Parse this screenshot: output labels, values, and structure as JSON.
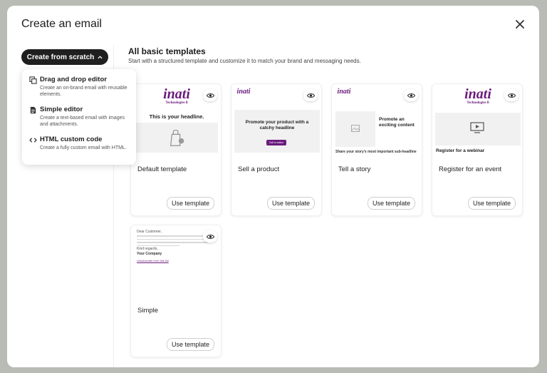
{
  "modal": {
    "title": "Create an email"
  },
  "sidebar": {
    "scratch_label": "Create from scratch",
    "menu": [
      {
        "title": "Drag and drop editor",
        "desc": "Create an on-brand email with reusable elements."
      },
      {
        "title": "Simple editor",
        "desc": "Create a text-based email with images and attachments."
      },
      {
        "title": "HTML custom code",
        "desc": "Create a fully custom email with HTML."
      }
    ]
  },
  "content": {
    "title": "All basic templates",
    "desc": "Start with a structured template and customize it to match your brand and messaging needs."
  },
  "templates": [
    {
      "name": "Default template",
      "use_label": "Use template"
    },
    {
      "name": "Sell a product",
      "use_label": "Use template"
    },
    {
      "name": "Tell a story",
      "use_label": "Use template"
    },
    {
      "name": "Register for an event",
      "use_label": "Use template"
    },
    {
      "name": "Simple",
      "use_label": "Use template"
    }
  ],
  "thumbs": {
    "logo_text": "inati",
    "logo_sub": "Technologies ll",
    "default_headline": "This is your headline.",
    "sell_headline": "Promote your product with a catchy headline",
    "sell_button": "Call to action",
    "story_headline": "Promote an exciting content",
    "story_sub": "Share your story's most important sub-headline",
    "event_headline": "Register for a webinar",
    "simple_greeting": "Dear Customer,",
    "simple_regards": "Kind regards,",
    "simple_sender": "Your Company",
    "simple_link": "Unsubscribe from this list"
  },
  "colors": {
    "brand": "#6a1b7d",
    "dark": "#1f1f1f",
    "backdrop": "#b9bcb5"
  }
}
